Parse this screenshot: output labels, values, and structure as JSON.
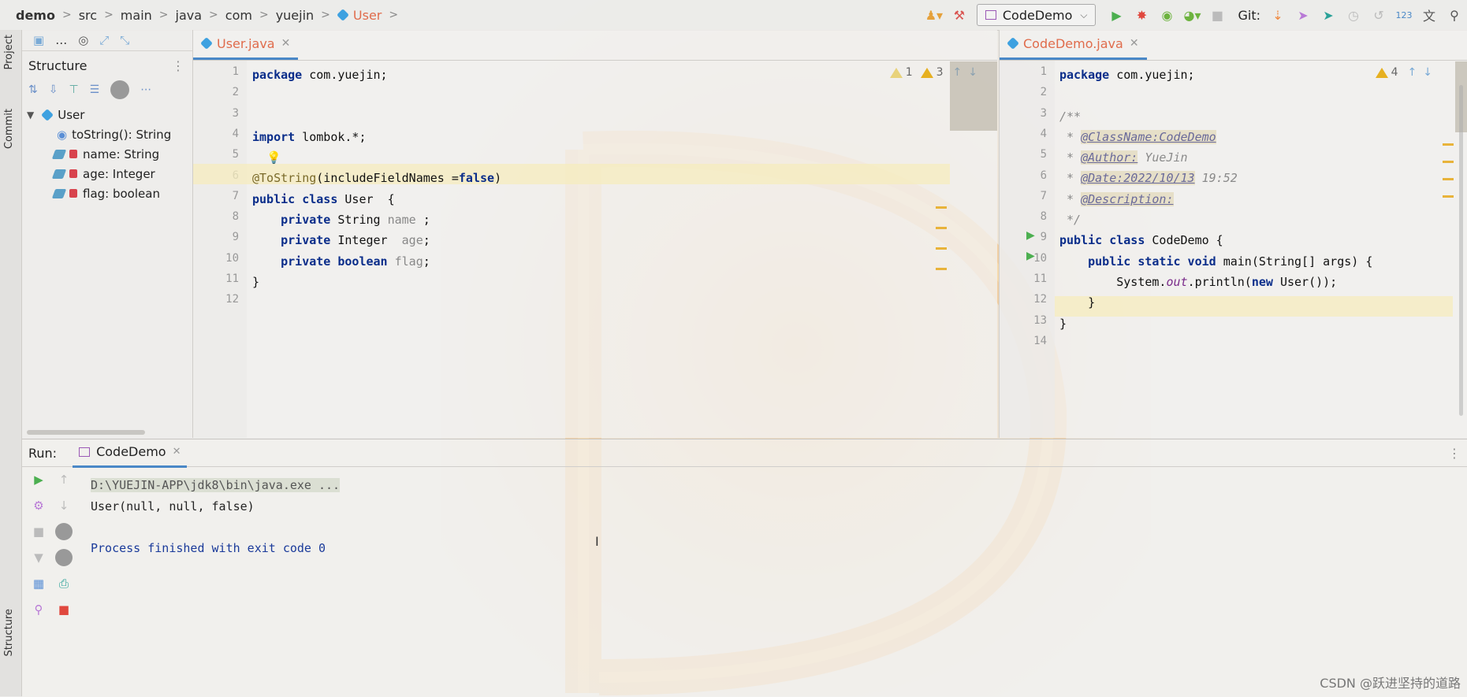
{
  "breadcrumb": [
    "demo",
    "src",
    "main",
    "java",
    "com",
    "yuejin",
    "User"
  ],
  "toolbar": {
    "run_config": "CodeDemo",
    "git_label": "Git:"
  },
  "side_labels": {
    "project": "Project",
    "commit": "Commit",
    "structure": "Structure"
  },
  "structure": {
    "title": "Structure",
    "root": "User",
    "members": [
      {
        "label": "toString(): String",
        "kind": "method"
      },
      {
        "label": "name: String",
        "kind": "field"
      },
      {
        "label": "age: Integer",
        "kind": "field"
      },
      {
        "label": "flag: boolean",
        "kind": "field"
      }
    ]
  },
  "editor_left": {
    "tab": "User.java",
    "warnings": "1",
    "weak_warnings": "3",
    "line_numbers": [
      "1",
      "2",
      "3",
      "4",
      "5",
      "6",
      "7",
      "8",
      "9",
      "10",
      "11",
      "12"
    ],
    "code": {
      "l1_kw": "package",
      "l1_rest": " com.yuejin;",
      "l4_kw": "import",
      "l4_rest": " lombok.*;",
      "l6_ann": "@ToString",
      "l6_rest": "(includeFieldNames =",
      "l6_kw": "false",
      "l6_close": ")",
      "l7_kw": "public class",
      "l7_rest": " User  {",
      "l8_kw": "private",
      "l8_type": " String ",
      "l8_field": "name",
      "l8_end": " ;",
      "l9_kw": "private",
      "l9_type": " Integer  ",
      "l9_field": "age",
      "l9_end": ";",
      "l10_kw": "private boolean",
      "l10_field": " flag",
      "l10_end": ";",
      "l11": "}"
    }
  },
  "editor_right": {
    "tab": "CodeDemo.java",
    "warnings": "4",
    "line_numbers": [
      "1",
      "2",
      "3",
      "4",
      "5",
      "6",
      "7",
      "8",
      "9",
      "10",
      "11",
      "12",
      "13",
      "14"
    ],
    "code": {
      "l1_kw": "package",
      "l1_rest": " com.yuejin;",
      "l3": "/**",
      "l4_star": " * ",
      "l4_tag": "@ClassName:CodeDemo",
      "l5_star": " * ",
      "l5_tag": "@Author:",
      "l5_val": " YueJin",
      "l6_star": " * ",
      "l6_tag": "@Date:2022/10/13",
      "l6_val": " 19:52",
      "l7_star": " * ",
      "l7_tag": "@Description:",
      "l8": " */",
      "l9_kw": "public class",
      "l9_rest": " CodeDemo {",
      "l10_kw": "    public static void",
      "l10_rest": " main(String[] args) {",
      "l11_a": "        System.",
      "l11_out": "out",
      "l11_b": ".println(",
      "l11_kw": "new",
      "l11_c": " User());",
      "l12": "    }",
      "l13": "}"
    }
  },
  "run_panel": {
    "label": "Run:",
    "tab": "CodeDemo",
    "cmd": "D:\\YUEJIN-APP\\jdk8\\bin\\java.exe ...",
    "output": "User(null, null, false)",
    "exit": "Process finished with exit code 0"
  },
  "watermark": "CSDN @跃进坚持的道路"
}
